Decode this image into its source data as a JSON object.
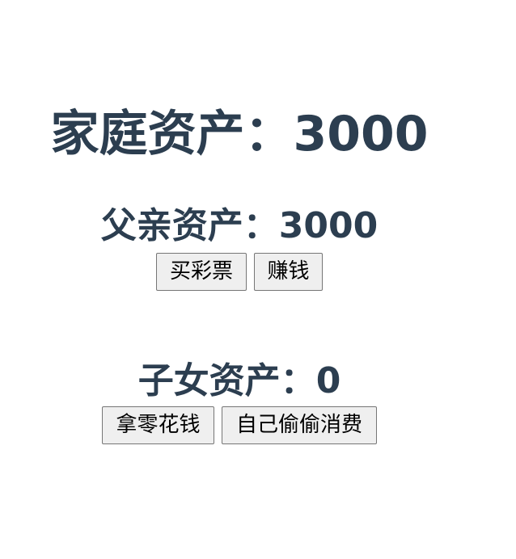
{
  "family": {
    "label": "家庭资产：",
    "value": "3000"
  },
  "father": {
    "label": "父亲资产：",
    "value": "3000",
    "buttons": {
      "lottery_label": "买彩票",
      "earn_label": "赚钱"
    }
  },
  "child": {
    "label": "子女资产：",
    "value": "0",
    "buttons": {
      "pocket_money_label": "拿零花钱",
      "secret_spend_label": "自己偷偷消费"
    }
  },
  "colors": {
    "heading_text": "#2c3e50",
    "button_bg": "#efefef",
    "button_border": "#767676"
  }
}
